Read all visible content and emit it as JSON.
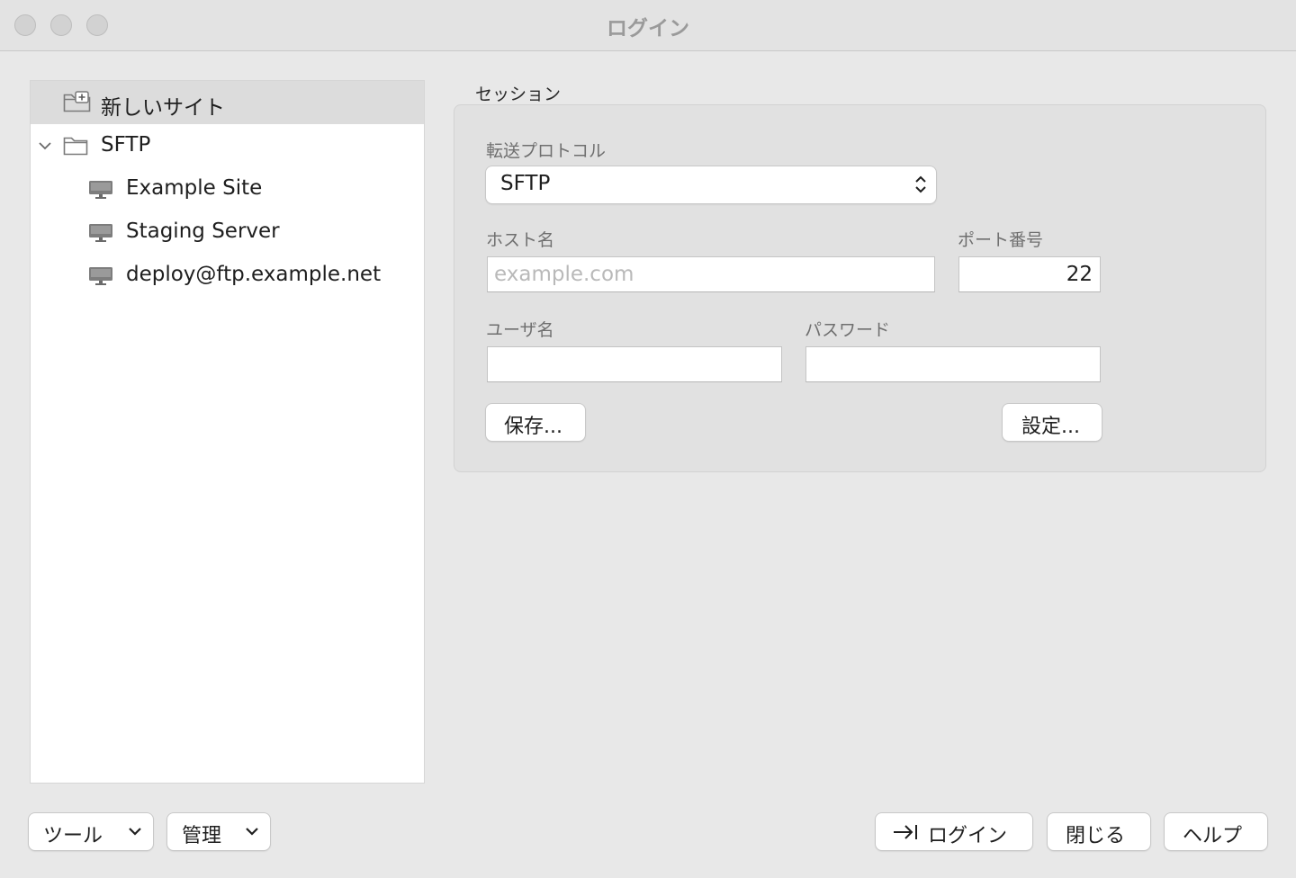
{
  "window": {
    "title": "ログイン"
  },
  "site_tree": {
    "new_site": "新しいサイト",
    "folder": "SFTP",
    "sites": [
      {
        "label": "Example Site"
      },
      {
        "label": "Staging Server"
      },
      {
        "label": "deploy@ftp.example.net"
      }
    ]
  },
  "session": {
    "group_title": "セッション",
    "protocol_label": "転送プロトコル",
    "protocol_value": "SFTP",
    "host_label": "ホスト名",
    "host_placeholder": "example.com",
    "host_value": "",
    "port_label": "ポート番号",
    "port_value": "22",
    "user_label": "ユーザ名",
    "user_value": "",
    "password_label": "パスワード",
    "password_value": "",
    "save_button": "保存...",
    "settings_button": "設定..."
  },
  "footer": {
    "tools_button": "ツール",
    "manage_button": "管理",
    "login_button": "ログイン",
    "close_button": "閉じる",
    "help_button": "ヘルプ"
  },
  "icons": {
    "new_site": "new-site-folder-icon",
    "folder": "folder-icon",
    "site": "computer-icon",
    "disclosure": "chevron-down-icon",
    "login": "arrow-right-to-bar-icon"
  }
}
